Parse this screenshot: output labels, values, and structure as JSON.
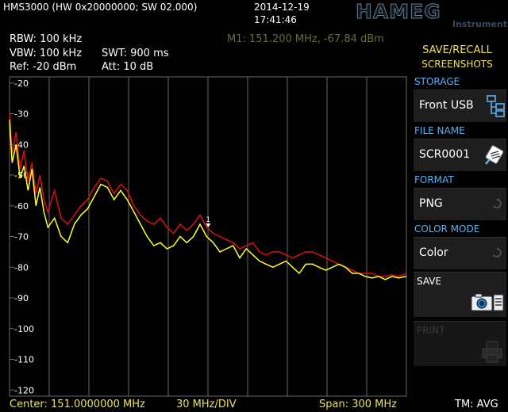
{
  "header": {
    "model": "HMS3000 (HW 0x20000000; SW 02.000)",
    "date": "2014-12-19",
    "time": "17:41:46",
    "brand": "HAMEG",
    "brand_sub": "Instruments"
  },
  "params": {
    "rbw": "RBW: 100 kHz",
    "vbw": "VBW: 100 kHz",
    "swt": "SWT: 900 ms",
    "ref": "Ref: -20 dBm",
    "att": "Att: 10 dB"
  },
  "marker": {
    "readout": "M1: 151.200 MHz, -67.84 dBm",
    "freq_mhz": 151.2,
    "level_dbm": -67.84
  },
  "panel": {
    "title_line1": "SAVE/RECALL",
    "title_line2": "SCREENSHOTS",
    "storage_label": "STORAGE",
    "storage_value": "Front USB",
    "filename_label": "FILE NAME",
    "filename_value": "SCR0001",
    "format_label": "FORMAT",
    "format_value": "PNG",
    "colormode_label": "COLOR MODE",
    "colormode_value": "Color",
    "save_label": "SAVE",
    "print_label": "PRINT"
  },
  "footer": {
    "center": "Center: 151.0000000 MHz",
    "div": "30 MHz/DIV",
    "span": "Span: 300 MHz",
    "trace_mode": "TM: AVG"
  },
  "colors": {
    "trace_avg": "#ffff33",
    "trace_max": "#dd1111",
    "grid": "#6a6a6a",
    "label_blue": "#5fb0ee",
    "title_yellow": "#f0e060"
  },
  "chart_data": {
    "type": "line",
    "xlabel": "",
    "ylabel": "",
    "x_range_mhz": [
      1,
      301
    ],
    "ylim": [
      -122,
      -18
    ],
    "y_ticks": [
      -20,
      -30,
      -40,
      -50,
      -60,
      -70,
      -80,
      -90,
      -100,
      -110,
      -120
    ],
    "y_tick_labels": [
      "-20",
      "-30",
      "-40",
      "-50",
      "-60",
      "-70",
      "-80",
      "-90",
      "-100",
      "-110",
      "-120"
    ],
    "grid": true,
    "series": [
      {
        "color": "#dd1111",
        "x": [
          1,
          3,
          6,
          9,
          12,
          15,
          18,
          21,
          24,
          27,
          30,
          35,
          40,
          45,
          50,
          55,
          60,
          65,
          70,
          75,
          80,
          85,
          90,
          95,
          100,
          105,
          110,
          115,
          120,
          125,
          130,
          135,
          140,
          145,
          150,
          155,
          160,
          165,
          170,
          175,
          180,
          185,
          190,
          195,
          200,
          205,
          210,
          215,
          220,
          225,
          230,
          235,
          240,
          245,
          250,
          255,
          260,
          265,
          270,
          275,
          280,
          285,
          290,
          295,
          301
        ],
        "y": [
          -30,
          -43,
          -36,
          -48,
          -42,
          -52,
          -46,
          -56,
          -50,
          -58,
          -62,
          -55,
          -64,
          -66,
          -63,
          -60,
          -58,
          -54,
          -51,
          -52,
          -56,
          -53,
          -55,
          -60,
          -63,
          -65,
          -66,
          -64,
          -67,
          -69,
          -66,
          -68,
          -66,
          -63,
          -67,
          -69,
          -70,
          -71,
          -72,
          -74,
          -73,
          -72,
          -75,
          -76,
          -75,
          -75,
          -76,
          -77,
          -76,
          -75,
          -75,
          -76,
          -77,
          -78,
          -79,
          -80,
          -81,
          -82,
          -82,
          -82,
          -83,
          -83,
          -82.5,
          -83,
          -82
        ]
      },
      {
        "color": "#ffff33",
        "x": [
          1,
          3,
          6,
          9,
          12,
          15,
          18,
          21,
          24,
          27,
          30,
          35,
          40,
          45,
          50,
          55,
          60,
          65,
          70,
          75,
          80,
          85,
          90,
          95,
          100,
          105,
          110,
          115,
          120,
          125,
          130,
          135,
          140,
          145,
          150,
          155,
          160,
          165,
          170,
          175,
          180,
          185,
          190,
          195,
          200,
          205,
          210,
          215,
          220,
          225,
          230,
          235,
          240,
          245,
          250,
          255,
          260,
          265,
          270,
          275,
          280,
          285,
          290,
          295,
          301
        ],
        "y": [
          -32,
          -46,
          -40,
          -51,
          -47,
          -55,
          -48,
          -60,
          -54,
          -62,
          -67,
          -64,
          -70,
          -72,
          -66,
          -63,
          -61,
          -57,
          -53,
          -54,
          -58,
          -55,
          -58,
          -62,
          -66,
          -70,
          -73,
          -72,
          -74,
          -73,
          -70,
          -72,
          -70,
          -66,
          -70,
          -72,
          -75,
          -74,
          -73,
          -77,
          -74,
          -76,
          -78,
          -79,
          -80,
          -79,
          -78,
          -80,
          -82,
          -79,
          -79,
          -80,
          -81,
          -80,
          -79,
          -80,
          -82,
          -82,
          -83,
          -83.5,
          -83,
          -84,
          -83,
          -83.5,
          -83
        ]
      }
    ],
    "marker_label": "1"
  }
}
